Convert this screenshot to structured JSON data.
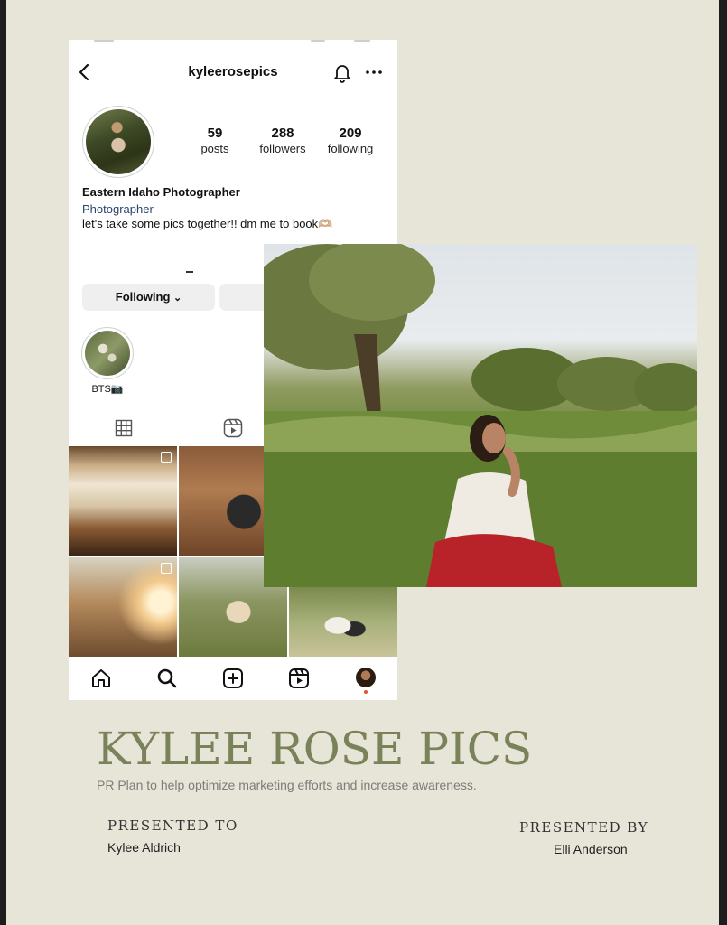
{
  "profile": {
    "username": "kyleerosepics",
    "stats": [
      {
        "value": "59",
        "label": "posts"
      },
      {
        "value": "288",
        "label": "followers"
      },
      {
        "value": "209",
        "label": "following"
      }
    ],
    "name": "Eastern Idaho Photographer",
    "category": "Photographer",
    "bio": "let's take some pics together!! dm me to book🫶🏼"
  },
  "actions": {
    "following_label": "Following",
    "following_chevron": "⌄"
  },
  "highlights": [
    {
      "label": "BTS📷"
    }
  ],
  "document": {
    "title": "KYLEE ROSE PICS",
    "subtitle": "PR Plan to help optimize marketing efforts and increase awareness.",
    "presented_to_heading": "PRESENTED TO",
    "presented_to_name": "Kylee Aldrich",
    "presented_by_heading": "PRESENTED BY",
    "presented_by_name": "Elli Anderson"
  },
  "icons": {
    "back": "back-arrow-icon",
    "notifications": "bell-icon",
    "more": "more-icon",
    "grid": "grid-icon",
    "reels": "reels-icon",
    "home": "home-icon",
    "search": "search-icon",
    "create": "create-icon"
  },
  "colors": {
    "page_background": "#e7e4d8",
    "title_olive": "#7a8259",
    "category_link": "#27466b"
  }
}
